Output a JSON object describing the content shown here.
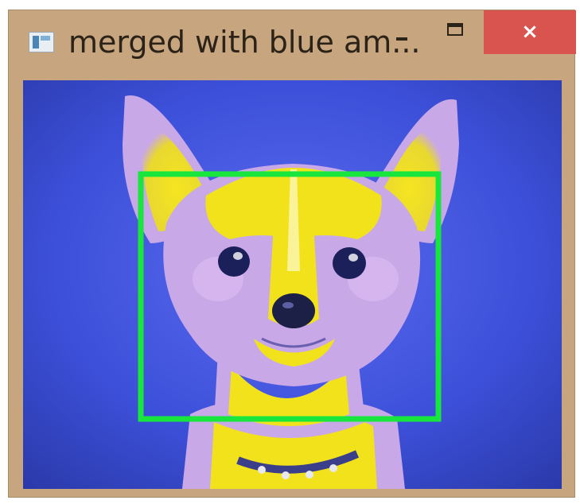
{
  "window": {
    "title": "merged with blue am...",
    "minimize_glyph": "",
    "maximize_glyph": "",
    "close_glyph": "×",
    "icon": "app-window-icon"
  },
  "image": {
    "subject": "chihuahua-face",
    "detection_box_color": "#19e63c",
    "background_color": "#3b4fd6",
    "highlight_color": "#f2e21c"
  }
}
